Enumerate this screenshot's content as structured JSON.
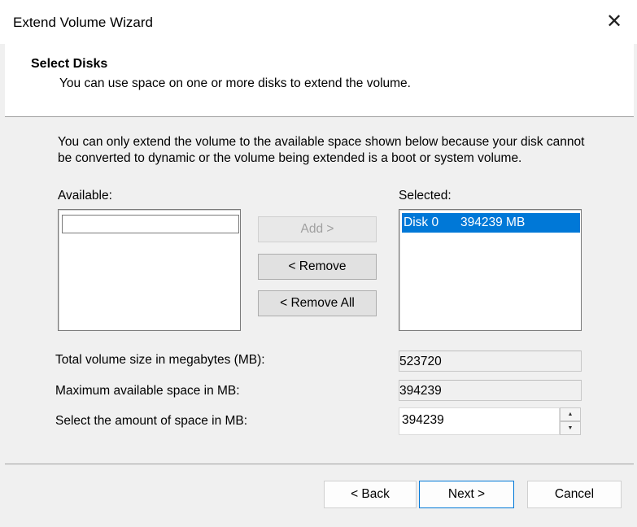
{
  "window": {
    "title": "Extend Volume Wizard",
    "close_icon": "close-icon"
  },
  "header": {
    "title": "Select Disks",
    "subtitle": "You can use space on one or more disks to extend the volume."
  },
  "info": {
    "text": "You can only extend the volume to the available space shown below because your disk cannot be converted to dynamic or the volume being extended is a boot or system volume."
  },
  "available": {
    "label": "Available:",
    "items": []
  },
  "selected": {
    "label": "Selected:",
    "items": [
      {
        "disk": "Disk 0",
        "size": "394239 MB"
      }
    ]
  },
  "buttons": {
    "add": "Add >",
    "remove": "< Remove",
    "remove_all": "< Remove All"
  },
  "fields": {
    "total_label": "Total volume size in megabytes (MB):",
    "total_value": "523720",
    "max_label": "Maximum available space in MB:",
    "max_value": "394239",
    "amount_label": "Select the amount of space in MB:",
    "amount_value": "394239"
  },
  "footer": {
    "back": "< Back",
    "next": "Next >",
    "cancel": "Cancel"
  }
}
